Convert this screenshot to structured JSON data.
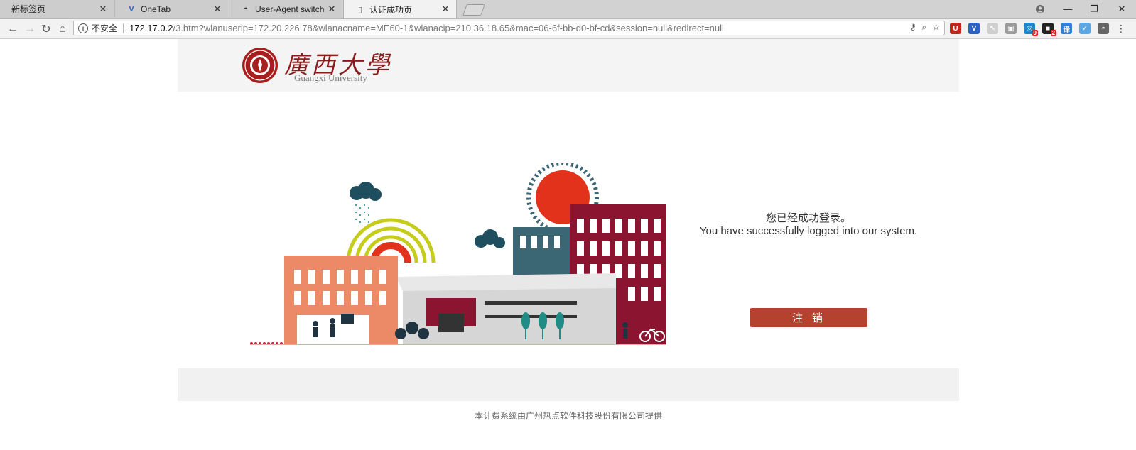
{
  "tabs": [
    {
      "title": "新标签页",
      "icon": "page-icon"
    },
    {
      "title": "OneTab",
      "icon": "onetab-icon"
    },
    {
      "title": "User-Agent switcher co",
      "icon": "mask-icon"
    },
    {
      "title": "认证成功页",
      "icon": "document-icon",
      "active": true
    }
  ],
  "toolbar": {
    "security_label": "不安全",
    "url_host": "172.17.0.2",
    "url_rest": "/3.htm?wlanuserip=172.20.226.78&wlanacname=ME60-1&wlanacip=210.36.18.65&mac=06-6f-bb-d0-bf-cd&session=null&redirect=null"
  },
  "extensions": [
    {
      "name": "ublock-icon",
      "color": "#c0271c",
      "glyph": "U"
    },
    {
      "name": "onetab-ext-icon",
      "color": "#2b63c5",
      "glyph": "V"
    },
    {
      "name": "cursor-ext-icon",
      "color": "#cfcfcf",
      "glyph": "↖"
    },
    {
      "name": "tab-ext-icon",
      "color": "#9a9a9a",
      "glyph": "▣",
      "badge": ""
    },
    {
      "name": "globe-ext-icon",
      "color": "#1e88c8",
      "glyph": "◎",
      "badge": "9"
    },
    {
      "name": "black-ext-icon",
      "color": "#222222",
      "glyph": "■",
      "badge": "2"
    },
    {
      "name": "translate-ext-icon",
      "color": "#2d7fe0",
      "glyph": "译"
    },
    {
      "name": "bird-ext-icon",
      "color": "#5aa7e6",
      "glyph": "✓"
    },
    {
      "name": "mask-ext-icon",
      "color": "#666666",
      "glyph": "◓"
    }
  ],
  "logo": {
    "cn": "廣西大學",
    "en": "Guangxi University"
  },
  "message": {
    "cn": "您已经成功登录。",
    "en": "You have successfully logged into our system."
  },
  "logout_label": "注 销",
  "footer": "本计费系统由广州热点软件科技股份有限公司提供"
}
